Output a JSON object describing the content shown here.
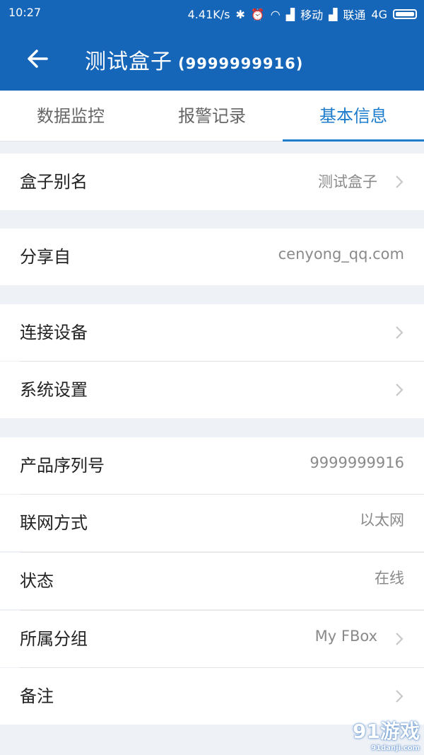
{
  "status": {
    "time": "10:27",
    "speed": "4.41K/s",
    "carrier1": "移动",
    "carrier2": "联通",
    "net": "4G"
  },
  "header": {
    "title": "测试盒子",
    "subtitle": "(9999999916)"
  },
  "tabs": [
    {
      "label": "数据监控"
    },
    {
      "label": "报警记录"
    },
    {
      "label": "基本信息"
    }
  ],
  "rows": {
    "alias": {
      "label": "盒子别名",
      "value": "测试盒子"
    },
    "shared": {
      "label": "分享自",
      "value": "cenyong_qq.com"
    },
    "devices": {
      "label": "连接设备"
    },
    "settings": {
      "label": "系统设置"
    },
    "serial": {
      "label": "产品序列号",
      "value": "9999999916"
    },
    "network": {
      "label": "联网方式",
      "value": "以太网"
    },
    "state": {
      "label": "状态",
      "value": "在线"
    },
    "group": {
      "label": "所属分组",
      "value": "My FBox"
    },
    "note": {
      "label": "备注"
    }
  },
  "watermark": {
    "main": "91游戏",
    "site": "91danji.com"
  },
  "colors": {
    "primary": "#1565b8",
    "accent": "#1d7ccc",
    "background": "#eef1f6"
  }
}
